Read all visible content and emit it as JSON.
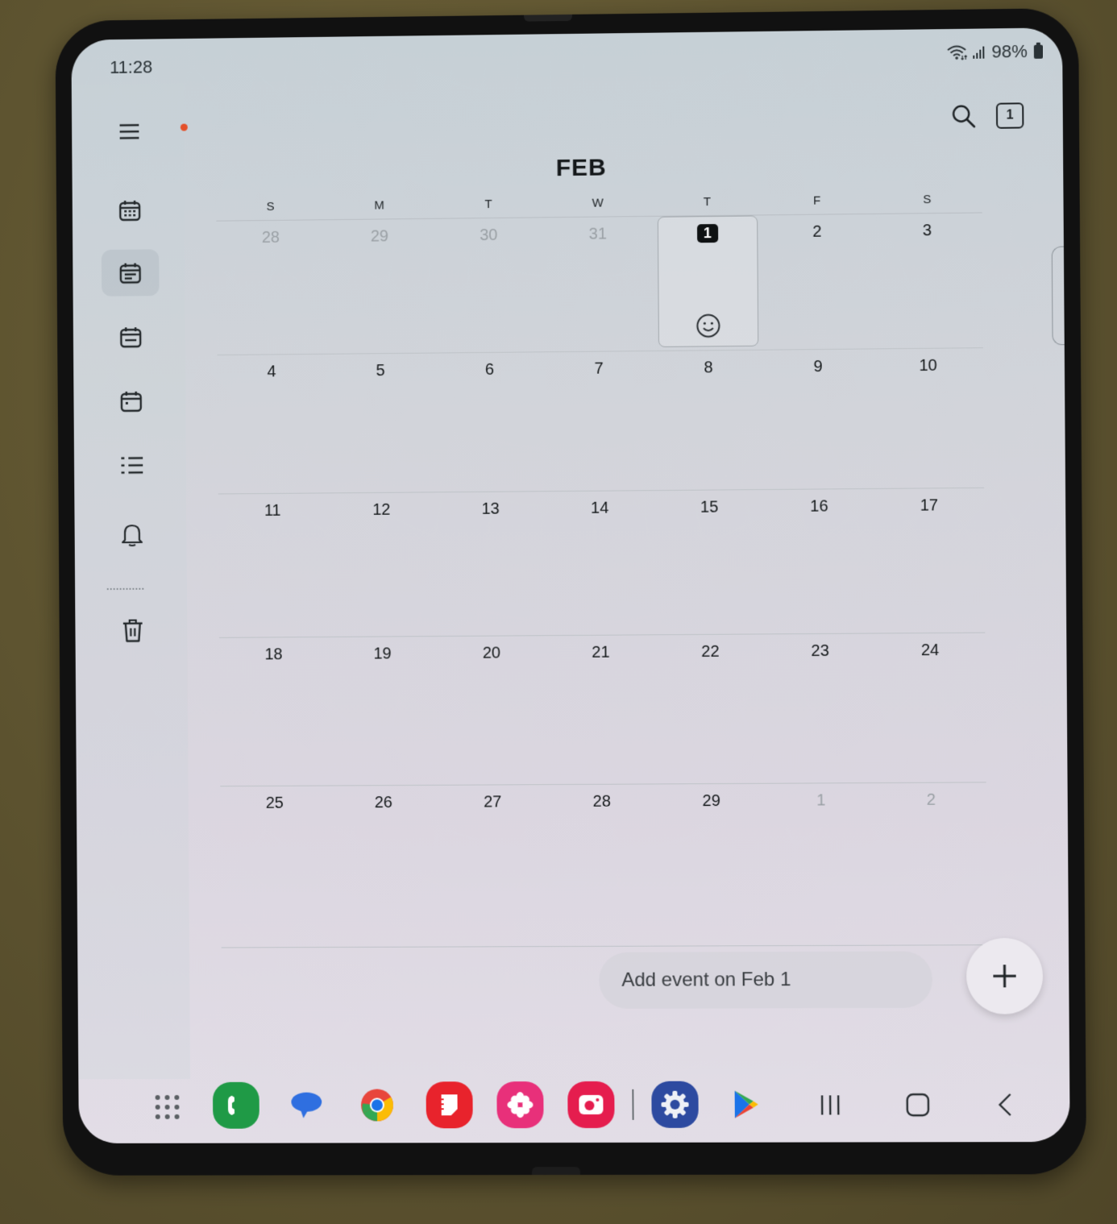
{
  "status_bar": {
    "time": "11:28",
    "battery": "98%",
    "icons": [
      "wifi-icon",
      "signal-icon",
      "battery-icon"
    ]
  },
  "sidebar": {
    "items": [
      {
        "name": "menu",
        "icon": "hamburger-menu-icon",
        "has_notification": true
      },
      {
        "name": "month-view",
        "icon": "calendar-month-icon"
      },
      {
        "name": "week-view",
        "icon": "calendar-week-icon",
        "active": true
      },
      {
        "name": "day-view",
        "icon": "calendar-day-icon"
      },
      {
        "name": "agenda-view",
        "icon": "calendar-dot-icon"
      },
      {
        "name": "list-view",
        "icon": "list-icon"
      },
      {
        "name": "reminders",
        "icon": "bell-icon"
      },
      {
        "name": "trash",
        "icon": "trash-icon"
      }
    ]
  },
  "top_actions": {
    "search_icon": "search-icon",
    "today_label": "1"
  },
  "calendar": {
    "month": "FEB",
    "weekdays": [
      "S",
      "M",
      "T",
      "W",
      "T",
      "F",
      "S"
    ],
    "weeks": [
      [
        {
          "d": "28",
          "other": true
        },
        {
          "d": "29",
          "other": true
        },
        {
          "d": "30",
          "other": true
        },
        {
          "d": "31",
          "other": true
        },
        {
          "d": "1",
          "today": true,
          "selected": true,
          "sticker": "smiley-icon"
        },
        {
          "d": "2"
        },
        {
          "d": "3"
        }
      ],
      [
        {
          "d": "4"
        },
        {
          "d": "5"
        },
        {
          "d": "6"
        },
        {
          "d": "7"
        },
        {
          "d": "8"
        },
        {
          "d": "9"
        },
        {
          "d": "10"
        }
      ],
      [
        {
          "d": "11"
        },
        {
          "d": "12"
        },
        {
          "d": "13"
        },
        {
          "d": "14"
        },
        {
          "d": "15"
        },
        {
          "d": "16"
        },
        {
          "d": "17"
        }
      ],
      [
        {
          "d": "18"
        },
        {
          "d": "19"
        },
        {
          "d": "20"
        },
        {
          "d": "21"
        },
        {
          "d": "22"
        },
        {
          "d": "23"
        },
        {
          "d": "24"
        }
      ],
      [
        {
          "d": "25"
        },
        {
          "d": "26"
        },
        {
          "d": "27"
        },
        {
          "d": "28"
        },
        {
          "d": "29"
        },
        {
          "d": "1",
          "other": true
        },
        {
          "d": "2",
          "other": true
        }
      ]
    ]
  },
  "add_event": {
    "placeholder": "Add event on Feb 1",
    "fab_icon": "plus-icon"
  },
  "taskbar": {
    "apps": [
      {
        "name": "phone",
        "color": "#1f9a46"
      },
      {
        "name": "messages",
        "color": "#2f6fe0"
      },
      {
        "name": "chrome",
        "color": "#e8453c"
      },
      {
        "name": "notes",
        "color": "#e8232c"
      },
      {
        "name": "gallery",
        "color": "#e8307a"
      },
      {
        "name": "camera",
        "color": "#e51d4e"
      },
      {
        "name": "settings",
        "color": "#2d4aa0"
      },
      {
        "name": "play-store",
        "color": "#34a853"
      }
    ],
    "nav": [
      "recents",
      "home",
      "back"
    ]
  }
}
